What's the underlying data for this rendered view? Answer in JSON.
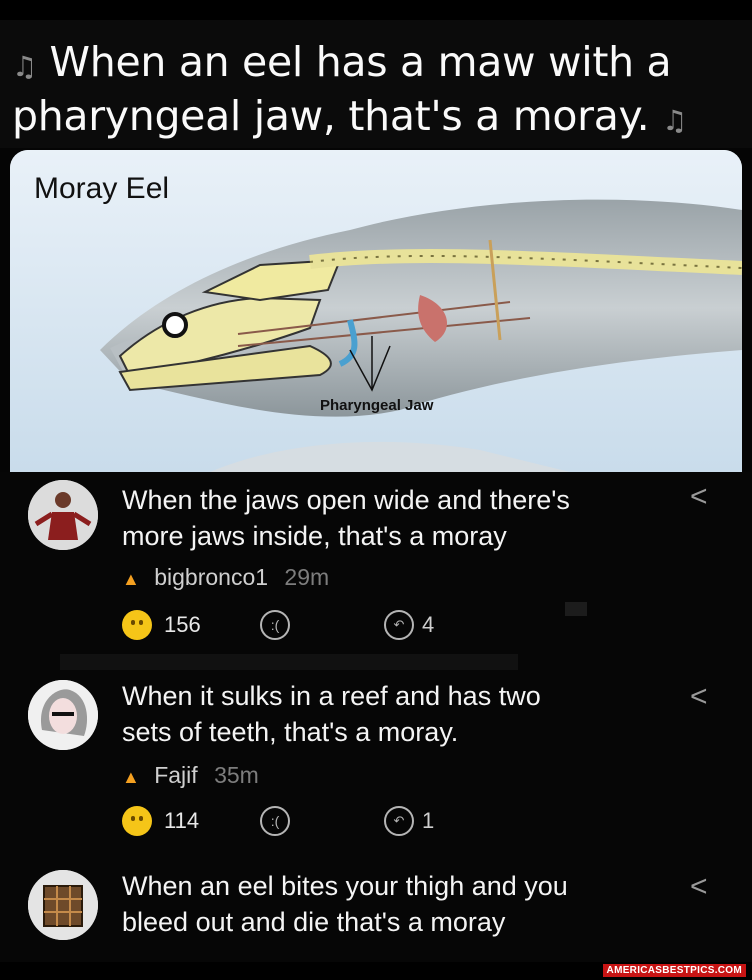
{
  "header": {
    "line1": "When an eel has a maw with a",
    "line2": "pharyngeal jaw, that's a moray.",
    "note_icon": "music-notes-icon"
  },
  "figure": {
    "title": "Moray Eel",
    "label": "Pharyngeal Jaw"
  },
  "comments": [
    {
      "text_line1": "When the jaws open wide and there's",
      "text_line2": "more jaws inside, that's a moray",
      "user": "bigbronco1",
      "time": "29m",
      "likes": "156",
      "replies": "4"
    },
    {
      "text_line1": "When it sulks in a reef and has two",
      "text_line2": "sets of teeth, that's a moray.",
      "user": "Fajif",
      "time": "35m",
      "likes": "114",
      "replies": "1"
    },
    {
      "text_line1": "When an eel bites your thigh and you",
      "text_line2": "bleed out and die that's a moray"
    }
  ],
  "share_glyph": "<",
  "watermark": "AMERICASBESTPICS.COM",
  "colors": {
    "background": "#050505",
    "like_emoji": "#f5c518",
    "fire": "#f4a020",
    "watermark_bg": "#c81414"
  }
}
